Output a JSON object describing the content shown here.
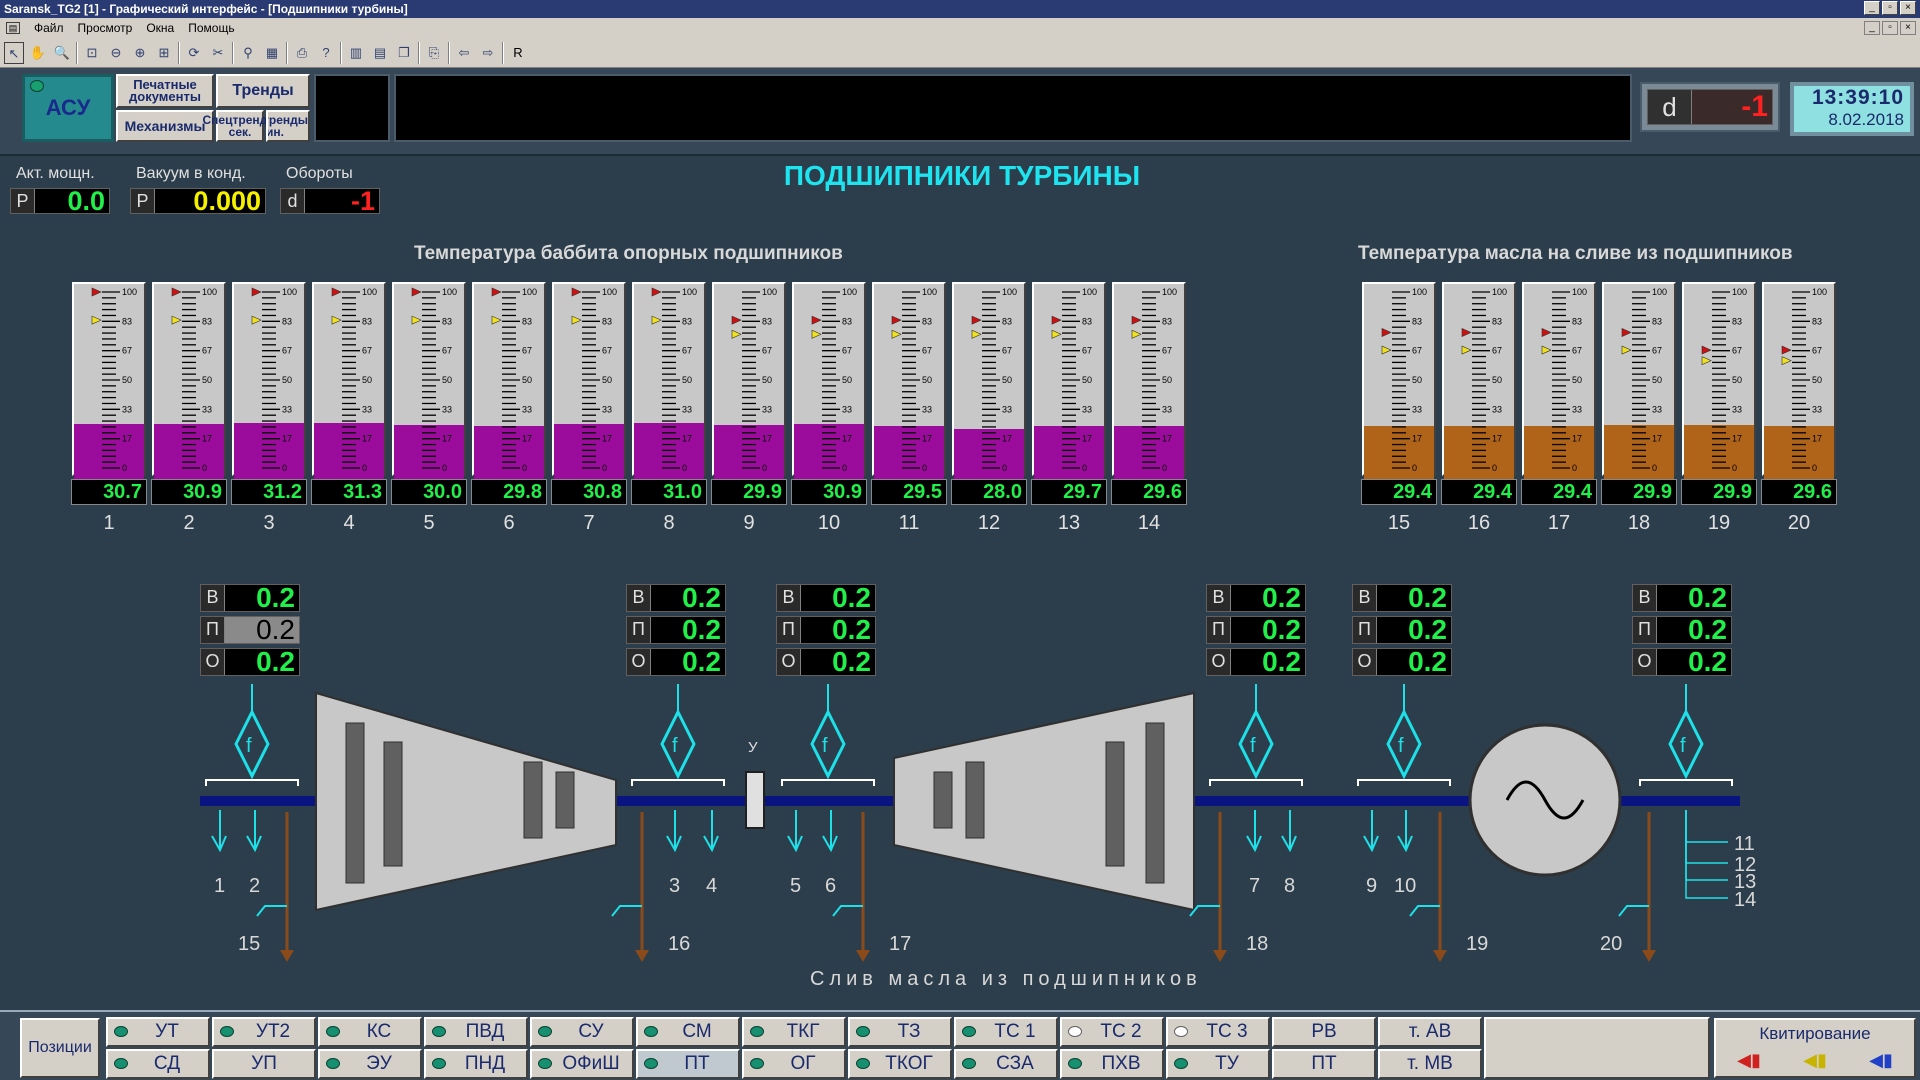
{
  "window": {
    "title": "Saransk_TG2 [1] - Графический интерфейс - [Подшипники турбины]"
  },
  "menu": [
    "Файл",
    "Просмотр",
    "Окна",
    "Помощь"
  ],
  "nav": {
    "asu": "АСУ",
    "print_docs": "Печатные документы",
    "trends": "Тренды",
    "mechanisms": "Механизмы",
    "spec_sec": "Спецтренды сек.",
    "spec_min": "Спецтренды мин.",
    "indicator_prefix": "d",
    "indicator_value": "-1",
    "clock_time": "13:39:10",
    "clock_date": "8.02.2018"
  },
  "params": [
    {
      "label": "Акт. мощн.",
      "prefix": "P",
      "value": "0.0",
      "color": "#22f04a"
    },
    {
      "label": "Вакуум в конд.",
      "prefix": "P",
      "value": "0.000",
      "color": "#f4f000"
    },
    {
      "label": "Обороты",
      "prefix": "d",
      "value": "-1",
      "color": "#ff2020"
    }
  ],
  "page_title": "ПОДШИПНИКИ ТУРБИНЫ",
  "babbit_title": "Температура баббита опорных подшипников",
  "oil_title": "Температура масла на сливе из подшипников",
  "scale_ticks": [
    "100",
    "83",
    "67",
    "50",
    "33",
    "17",
    "0"
  ],
  "colors": {
    "babbit_fill": "#9c0c9c",
    "oil_fill": "#b0641a",
    "value_green": "#22f04a",
    "title_cyan": "#1ee4f0"
  },
  "babbit_gauges": [
    {
      "n": "1",
      "value": "30.7",
      "level": 30.7,
      "red": 100,
      "yellow": 84
    },
    {
      "n": "2",
      "value": "30.9",
      "level": 30.9,
      "red": 100,
      "yellow": 84
    },
    {
      "n": "3",
      "value": "31.2",
      "level": 31.2,
      "red": 100,
      "yellow": 84
    },
    {
      "n": "4",
      "value": "31.3",
      "level": 31.3,
      "red": 100,
      "yellow": 84
    },
    {
      "n": "5",
      "value": "30.0",
      "level": 30.0,
      "red": 100,
      "yellow": 84
    },
    {
      "n": "6",
      "value": "29.8",
      "level": 29.8,
      "red": 100,
      "yellow": 84
    },
    {
      "n": "7",
      "value": "30.8",
      "level": 30.8,
      "red": 100,
      "yellow": 84
    },
    {
      "n": "8",
      "value": "31.0",
      "level": 31.0,
      "red": 100,
      "yellow": 84
    },
    {
      "n": "9",
      "value": "29.9",
      "level": 29.9,
      "red": 84,
      "yellow": 76
    },
    {
      "n": "10",
      "value": "30.9",
      "level": 30.9,
      "red": 84,
      "yellow": 76
    },
    {
      "n": "11",
      "value": "29.5",
      "level": 29.5,
      "red": 84,
      "yellow": 76
    },
    {
      "n": "12",
      "value": "28.0",
      "level": 28.0,
      "red": 84,
      "yellow": 76
    },
    {
      "n": "13",
      "value": "29.7",
      "level": 29.7,
      "red": 84,
      "yellow": 76
    },
    {
      "n": "14",
      "value": "29.6",
      "level": 29.6,
      "red": 84,
      "yellow": 76
    }
  ],
  "oil_gauges": [
    {
      "n": "15",
      "value": "29.4",
      "level": 29.4,
      "red": 77,
      "yellow": 67
    },
    {
      "n": "16",
      "value": "29.4",
      "level": 29.4,
      "red": 77,
      "yellow": 67
    },
    {
      "n": "17",
      "value": "29.4",
      "level": 29.4,
      "red": 77,
      "yellow": 67
    },
    {
      "n": "18",
      "value": "29.9",
      "level": 29.9,
      "red": 77,
      "yellow": 67
    },
    {
      "n": "19",
      "value": "29.9",
      "level": 29.9,
      "red": 67,
      "yellow": 61
    },
    {
      "n": "20",
      "value": "29.6",
      "level": 29.6,
      "red": 67,
      "yellow": 61
    }
  ],
  "vibration": [
    {
      "B": "0.2",
      "П": "0.2",
      "О": "0.2",
      "p_gray": true
    },
    {
      "B": "0.2",
      "П": "0.2",
      "О": "0.2"
    },
    {
      "B": "0.2",
      "П": "0.2",
      "О": "0.2"
    },
    {
      "B": "0.2",
      "П": "0.2",
      "О": "0.2"
    },
    {
      "B": "0.2",
      "П": "0.2",
      "О": "0.2"
    },
    {
      "B": "0.2",
      "П": "0.2",
      "О": "0.2"
    }
  ],
  "vib_keys": [
    "В",
    "П",
    "О"
  ],
  "diagram": {
    "coupling_label": "У",
    "f_label": "f",
    "drain_caption": "Слив масла из подшипников",
    "sensor_labels": [
      "1",
      "2",
      "3",
      "4",
      "5",
      "6",
      "7",
      "8",
      "9",
      "10",
      "11",
      "12",
      "13",
      "14"
    ],
    "drain_labels": [
      "15",
      "16",
      "17",
      "18",
      "19",
      "20"
    ]
  },
  "bottom": {
    "pos_label": "Позиции",
    "row1": [
      "УТ",
      "УТ2",
      "КС",
      "ПВД",
      "СУ",
      "СМ",
      "ТКГ",
      "ТЗ",
      "ТС 1",
      "ТС 2",
      "ТС 3",
      "РВ",
      "т. АВ"
    ],
    "row2": [
      "СД",
      "УП",
      "ЭУ",
      "ПНД",
      "ОФиШ",
      "ПТ",
      "ОГ",
      "ТКОГ",
      "СЗА",
      "ПХВ",
      "ТУ",
      "ПТ",
      "т. МВ"
    ],
    "ack": "Квитирование"
  }
}
